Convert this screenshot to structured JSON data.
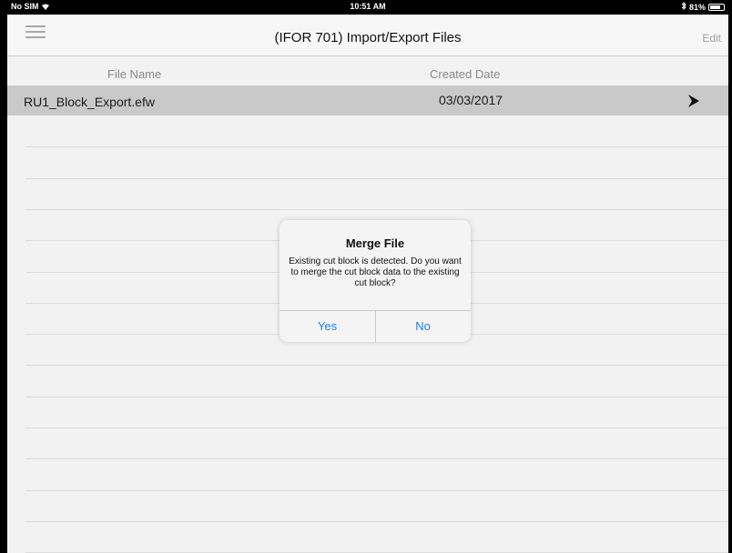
{
  "status_bar": {
    "carrier": "No SIM",
    "time": "10:51 AM",
    "battery": "81%",
    "battery_level": 0.81
  },
  "nav": {
    "title": "(IFOR 701) Import/Export Files",
    "edit_label": "Edit"
  },
  "table": {
    "headers": {
      "file_name": "File Name",
      "created_date": "Created Date"
    },
    "rows": [
      {
        "file_name": "RU1_Block_Export.efw",
        "created_date": "03/03/2017"
      }
    ]
  },
  "alert": {
    "title": "Merge File",
    "message": "Existing cut block is detected. Do you want to merge the cut block data to the existing cut block?",
    "yes_label": "Yes",
    "no_label": "No"
  },
  "colors": {
    "accent": "#1e7fe3",
    "selected_row": "#c9c9c9",
    "background": "#f2f2f2"
  },
  "icons": {
    "menu": "hamburger-menu-icon",
    "row": "chevron-right-icon",
    "wifi": "wifi-icon",
    "bluetooth": "bluetooth-icon",
    "battery": "battery-icon"
  }
}
